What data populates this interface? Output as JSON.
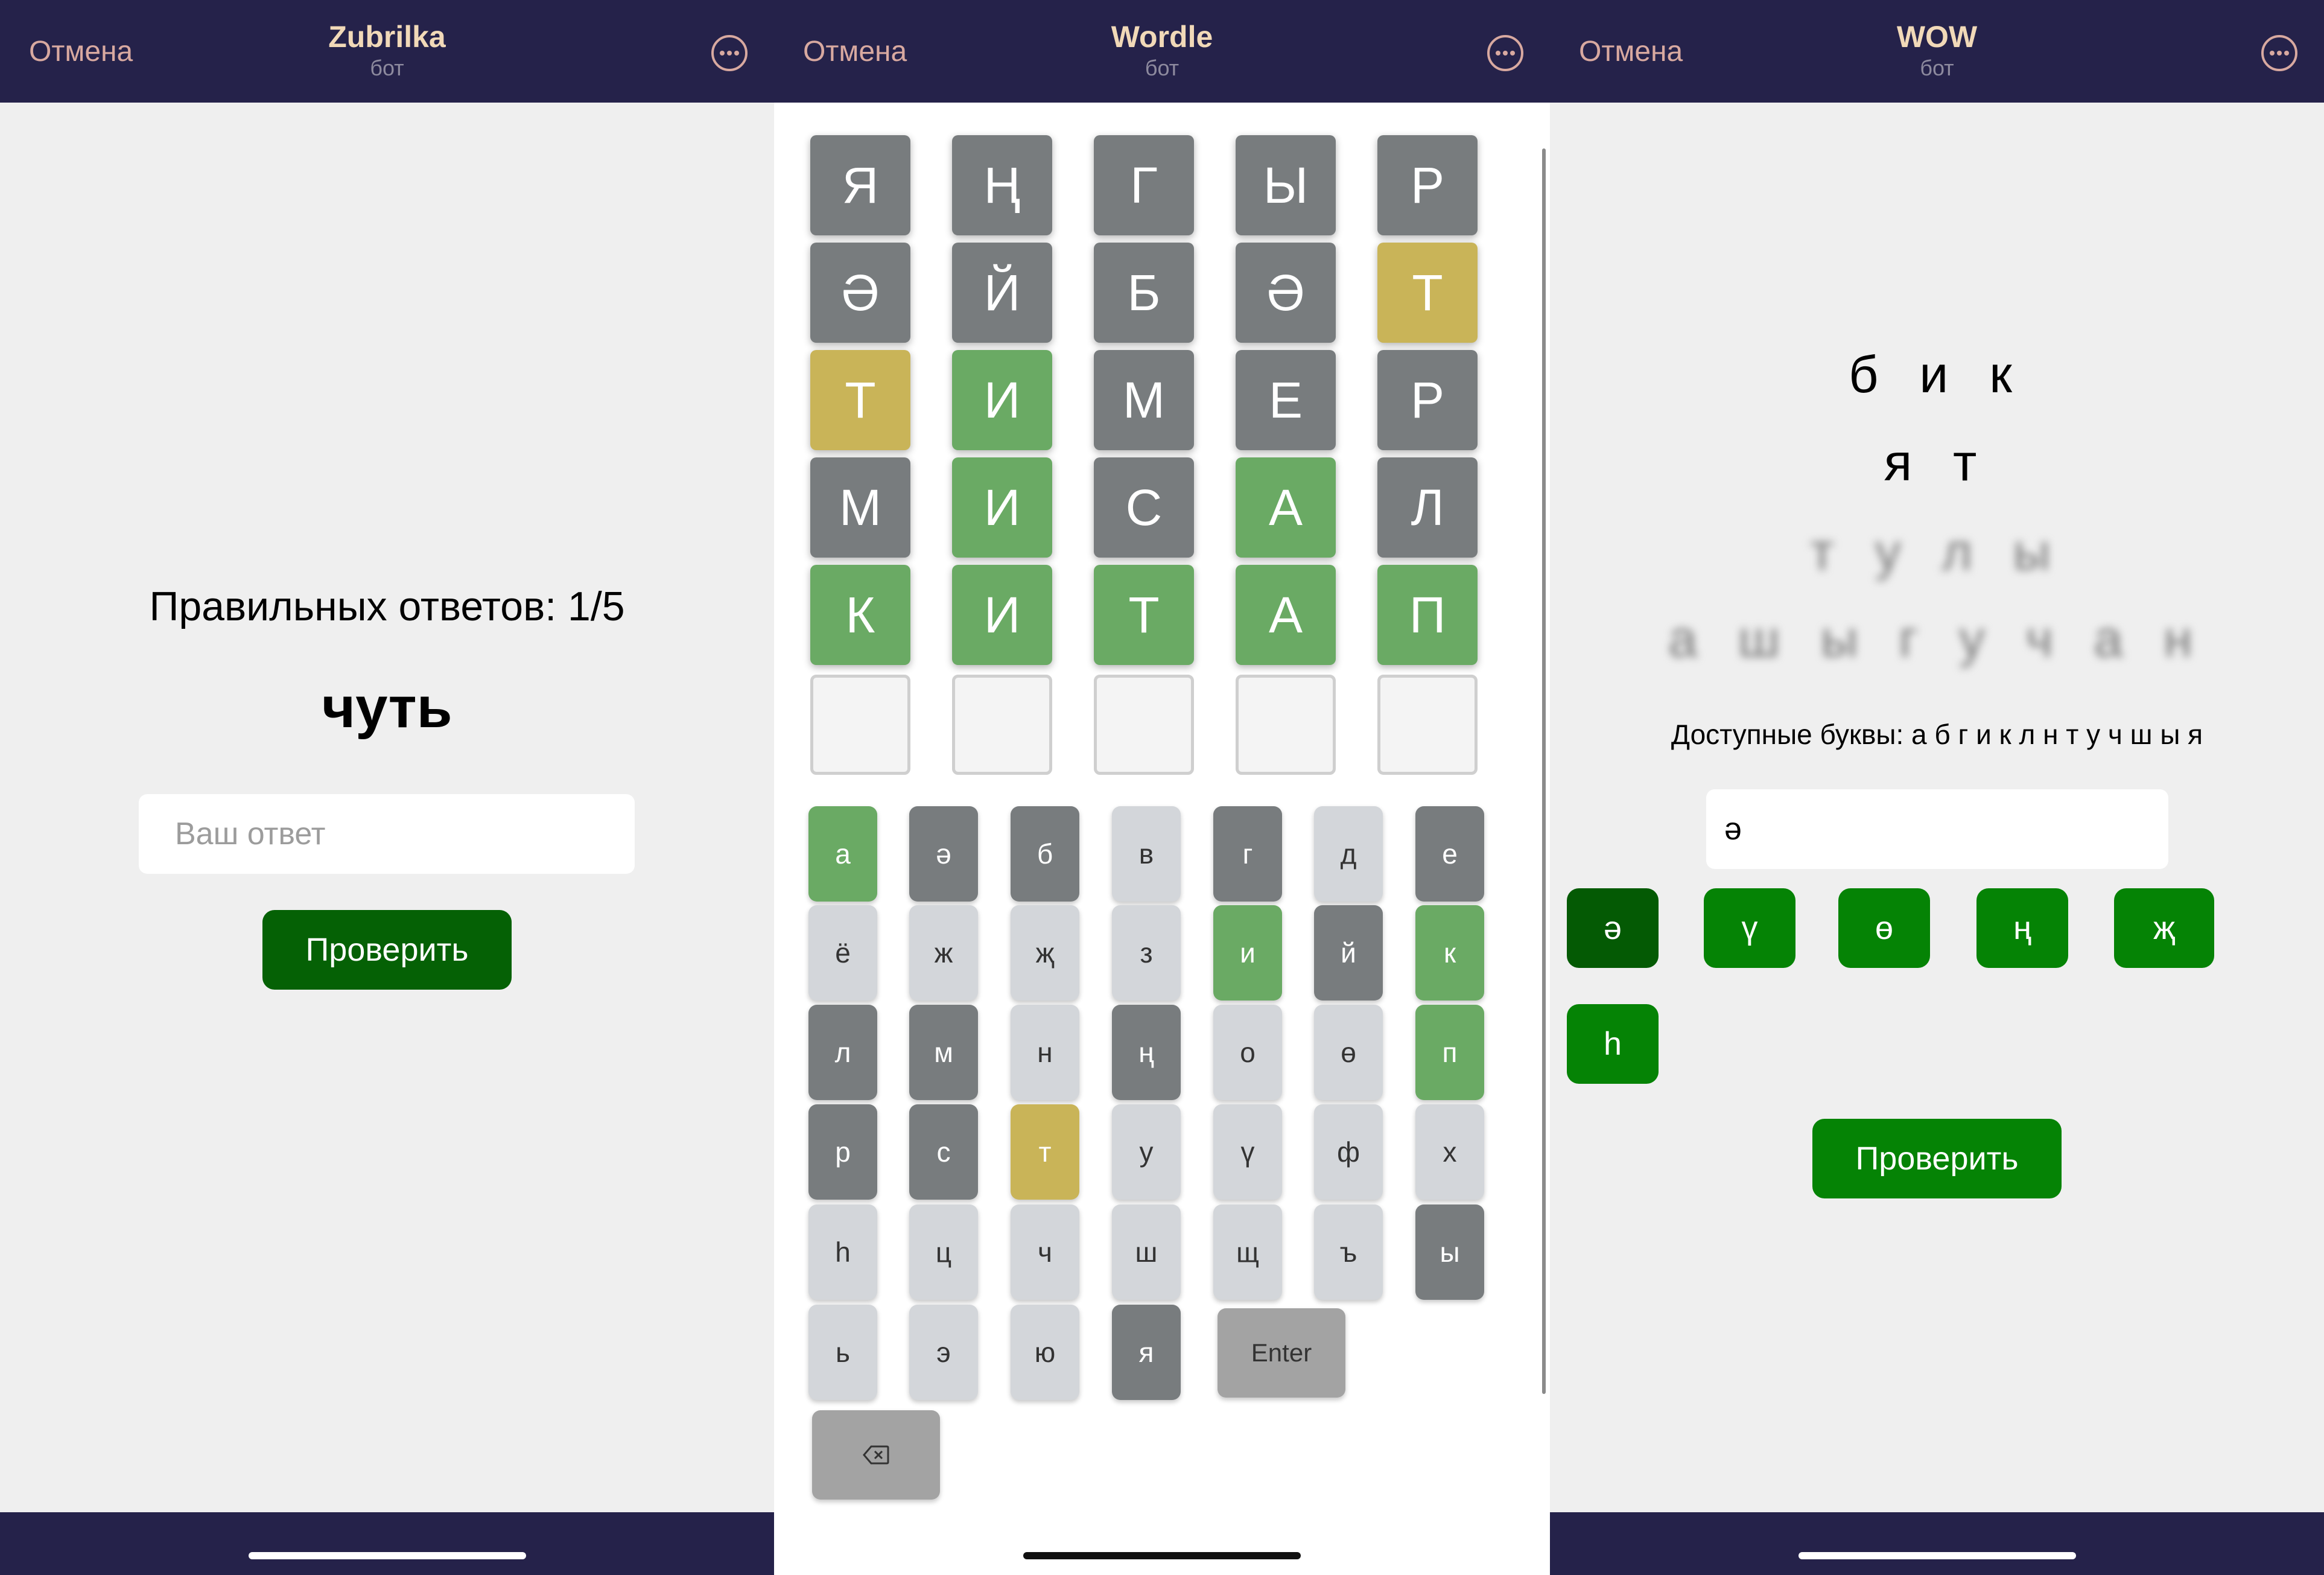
{
  "colors": {
    "header_bg": "#25224a",
    "title_color": "#f1d9b8",
    "cancel_color": "#d8a9a0",
    "tile_gray": "#787c7e",
    "tile_yellow": "#c9b458",
    "tile_green": "#6aaa64",
    "key_light": "#d3d6da",
    "key_dark": "#787c7e",
    "button_green": "#056105",
    "letter_button_green": "#058305",
    "letter_button_selected": "#045a04"
  },
  "screens": [
    {
      "header": {
        "cancel": "Отмена",
        "title": "Zubrilka",
        "subtitle": "бот",
        "more_icon": "more-icon"
      },
      "counter_text": "Правильных ответов: 1/5",
      "word": "чуть",
      "answer_placeholder": "Ваш ответ",
      "answer_value": "",
      "check_label": "Проверить"
    },
    {
      "header": {
        "cancel": "Отмена",
        "title": "Wordle",
        "subtitle": "бот",
        "more_icon": "more-icon"
      },
      "board": [
        [
          {
            "ch": "Я",
            "st": "gray"
          },
          {
            "ch": "Ң",
            "st": "gray"
          },
          {
            "ch": "Г",
            "st": "gray"
          },
          {
            "ch": "Ы",
            "st": "gray"
          },
          {
            "ch": "Р",
            "st": "gray"
          }
        ],
        [
          {
            "ch": "Ә",
            "st": "gray"
          },
          {
            "ch": "Й",
            "st": "gray"
          },
          {
            "ch": "Б",
            "st": "gray"
          },
          {
            "ch": "Ә",
            "st": "gray"
          },
          {
            "ch": "Т",
            "st": "yellow"
          }
        ],
        [
          {
            "ch": "Т",
            "st": "yellow"
          },
          {
            "ch": "И",
            "st": "green"
          },
          {
            "ch": "М",
            "st": "gray"
          },
          {
            "ch": "Е",
            "st": "gray"
          },
          {
            "ch": "Р",
            "st": "gray"
          }
        ],
        [
          {
            "ch": "М",
            "st": "gray"
          },
          {
            "ch": "И",
            "st": "green"
          },
          {
            "ch": "С",
            "st": "gray"
          },
          {
            "ch": "А",
            "st": "green"
          },
          {
            "ch": "Л",
            "st": "gray"
          }
        ],
        [
          {
            "ch": "К",
            "st": "green"
          },
          {
            "ch": "И",
            "st": "green"
          },
          {
            "ch": "Т",
            "st": "green"
          },
          {
            "ch": "А",
            "st": "green"
          },
          {
            "ch": "П",
            "st": "green"
          }
        ],
        [
          {
            "ch": "",
            "st": "empty"
          },
          {
            "ch": "",
            "st": "empty"
          },
          {
            "ch": "",
            "st": "empty"
          },
          {
            "ch": "",
            "st": "empty"
          },
          {
            "ch": "",
            "st": "empty"
          }
        ]
      ],
      "keyboard": [
        [
          {
            "k": "а",
            "st": "green"
          },
          {
            "k": "ә",
            "st": "dark"
          },
          {
            "k": "б",
            "st": "dark"
          },
          {
            "k": "в",
            "st": "light"
          },
          {
            "k": "г",
            "st": "dark"
          },
          {
            "k": "д",
            "st": "light"
          },
          {
            "k": "е",
            "st": "dark"
          }
        ],
        [
          {
            "k": "ё",
            "st": "light"
          },
          {
            "k": "ж",
            "st": "light"
          },
          {
            "k": "җ",
            "st": "light"
          },
          {
            "k": "з",
            "st": "light"
          },
          {
            "k": "и",
            "st": "green"
          },
          {
            "k": "й",
            "st": "dark"
          },
          {
            "k": "к",
            "st": "green"
          }
        ],
        [
          {
            "k": "л",
            "st": "dark"
          },
          {
            "k": "м",
            "st": "dark"
          },
          {
            "k": "н",
            "st": "light"
          },
          {
            "k": "ң",
            "st": "dark"
          },
          {
            "k": "о",
            "st": "light"
          },
          {
            "k": "ө",
            "st": "light"
          },
          {
            "k": "п",
            "st": "green"
          }
        ],
        [
          {
            "k": "р",
            "st": "dark"
          },
          {
            "k": "с",
            "st": "dark"
          },
          {
            "k": "т",
            "st": "yellow"
          },
          {
            "k": "у",
            "st": "light"
          },
          {
            "k": "ү",
            "st": "light"
          },
          {
            "k": "ф",
            "st": "light"
          },
          {
            "k": "х",
            "st": "light"
          }
        ],
        [
          {
            "k": "һ",
            "st": "light"
          },
          {
            "k": "ц",
            "st": "light"
          },
          {
            "k": "ч",
            "st": "light"
          },
          {
            "k": "ш",
            "st": "light"
          },
          {
            "k": "щ",
            "st": "light"
          },
          {
            "k": "ъ",
            "st": "light"
          },
          {
            "k": "ы",
            "st": "dark"
          }
        ],
        [
          {
            "k": "ь",
            "st": "light"
          },
          {
            "k": "э",
            "st": "light"
          },
          {
            "k": "ю",
            "st": "light"
          },
          {
            "k": "я",
            "st": "dark"
          }
        ]
      ],
      "enter_label": "Enter",
      "backspace_icon": "backspace-icon"
    },
    {
      "header": {
        "cancel": "Отмена",
        "title": "WOW",
        "subtitle": "бот",
        "more_icon": "more-icon"
      },
      "words": [
        {
          "text": "б и к",
          "hidden": false
        },
        {
          "text": "я т",
          "hidden": false
        },
        {
          "text": "т у л ы",
          "hidden": true
        },
        {
          "text": "а ш ы г у ч а н",
          "hidden": true
        }
      ],
      "available_letters": "Доступные буквы: а б г и к л н т у ч ш ы я",
      "input_value": "ә",
      "letter_buttons": [
        "ә",
        "ү",
        "ө",
        "ң",
        "җ",
        "һ"
      ],
      "check_label": "Проверить"
    }
  ]
}
